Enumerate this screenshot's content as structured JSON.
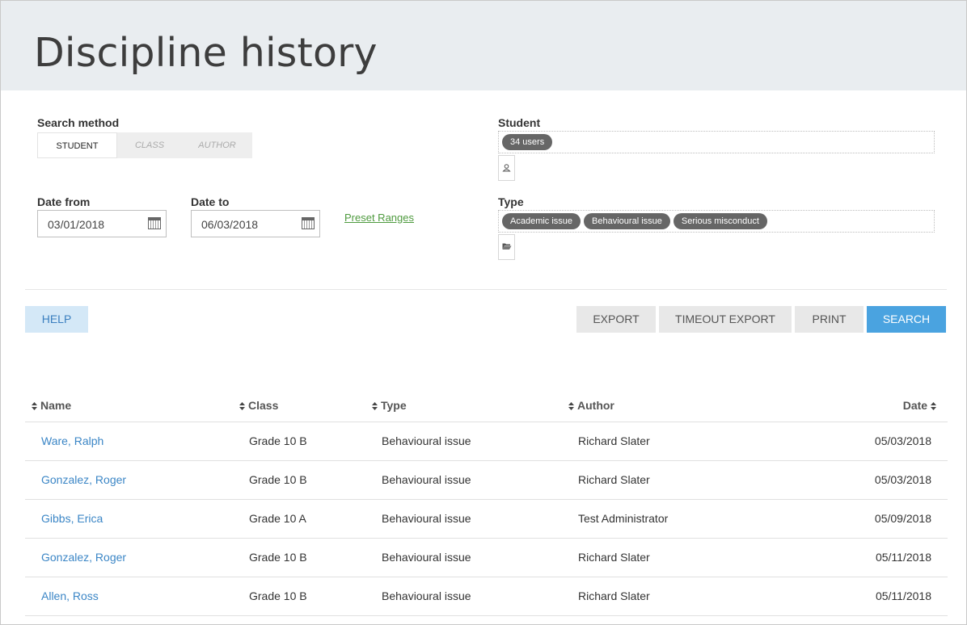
{
  "page": {
    "title": "Discipline history"
  },
  "search_method": {
    "label": "Search method",
    "options": [
      "STUDENT",
      "CLASS",
      "AUTHOR"
    ],
    "selected": "STUDENT"
  },
  "date_from": {
    "label": "Date from",
    "value": "03/01/2018"
  },
  "date_to": {
    "label": "Date to",
    "value": "06/03/2018"
  },
  "preset_ranges": "Preset Ranges",
  "student": {
    "label": "Student",
    "chips": [
      "34 users"
    ]
  },
  "type": {
    "label": "Type",
    "chips": [
      "Academic issue",
      "Behavioural issue",
      "Serious misconduct"
    ]
  },
  "buttons": {
    "help": "HELP",
    "export": "EXPORT",
    "timeout_export": "TIMEOUT EXPORT",
    "print": "PRINT",
    "search": "SEARCH"
  },
  "table": {
    "columns": [
      "Name",
      "Class",
      "Type",
      "Author",
      "Date"
    ],
    "rows": [
      [
        "Ware, Ralph",
        "Grade 10 B",
        "Behavioural issue",
        "Richard Slater",
        "05/03/2018"
      ],
      [
        "Gonzalez, Roger",
        "Grade 10 B",
        "Behavioural issue",
        "Richard Slater",
        "05/03/2018"
      ],
      [
        "Gibbs, Erica",
        "Grade 10 A",
        "Behavioural issue",
        "Test Administrator",
        "05/09/2018"
      ],
      [
        "Gonzalez, Roger",
        "Grade 10 B",
        "Behavioural issue",
        "Richard Slater",
        "05/11/2018"
      ],
      [
        "Allen, Ross",
        "Grade 10 B",
        "Behavioural issue",
        "Richard Slater",
        "05/11/2018"
      ]
    ]
  },
  "colors": {
    "header_bg": "#e9edf0",
    "link": "#3b86c6",
    "search_button": "#4aa3e0",
    "help_button": "#d4e8f7",
    "chip": "#666666",
    "preset_link": "#4e9a3e"
  },
  "icons": {
    "date_picker": "calendar-icon",
    "student_picker": "user-icon",
    "type_picker": "folder-open-icon",
    "sort": "sort-arrows-icon"
  }
}
